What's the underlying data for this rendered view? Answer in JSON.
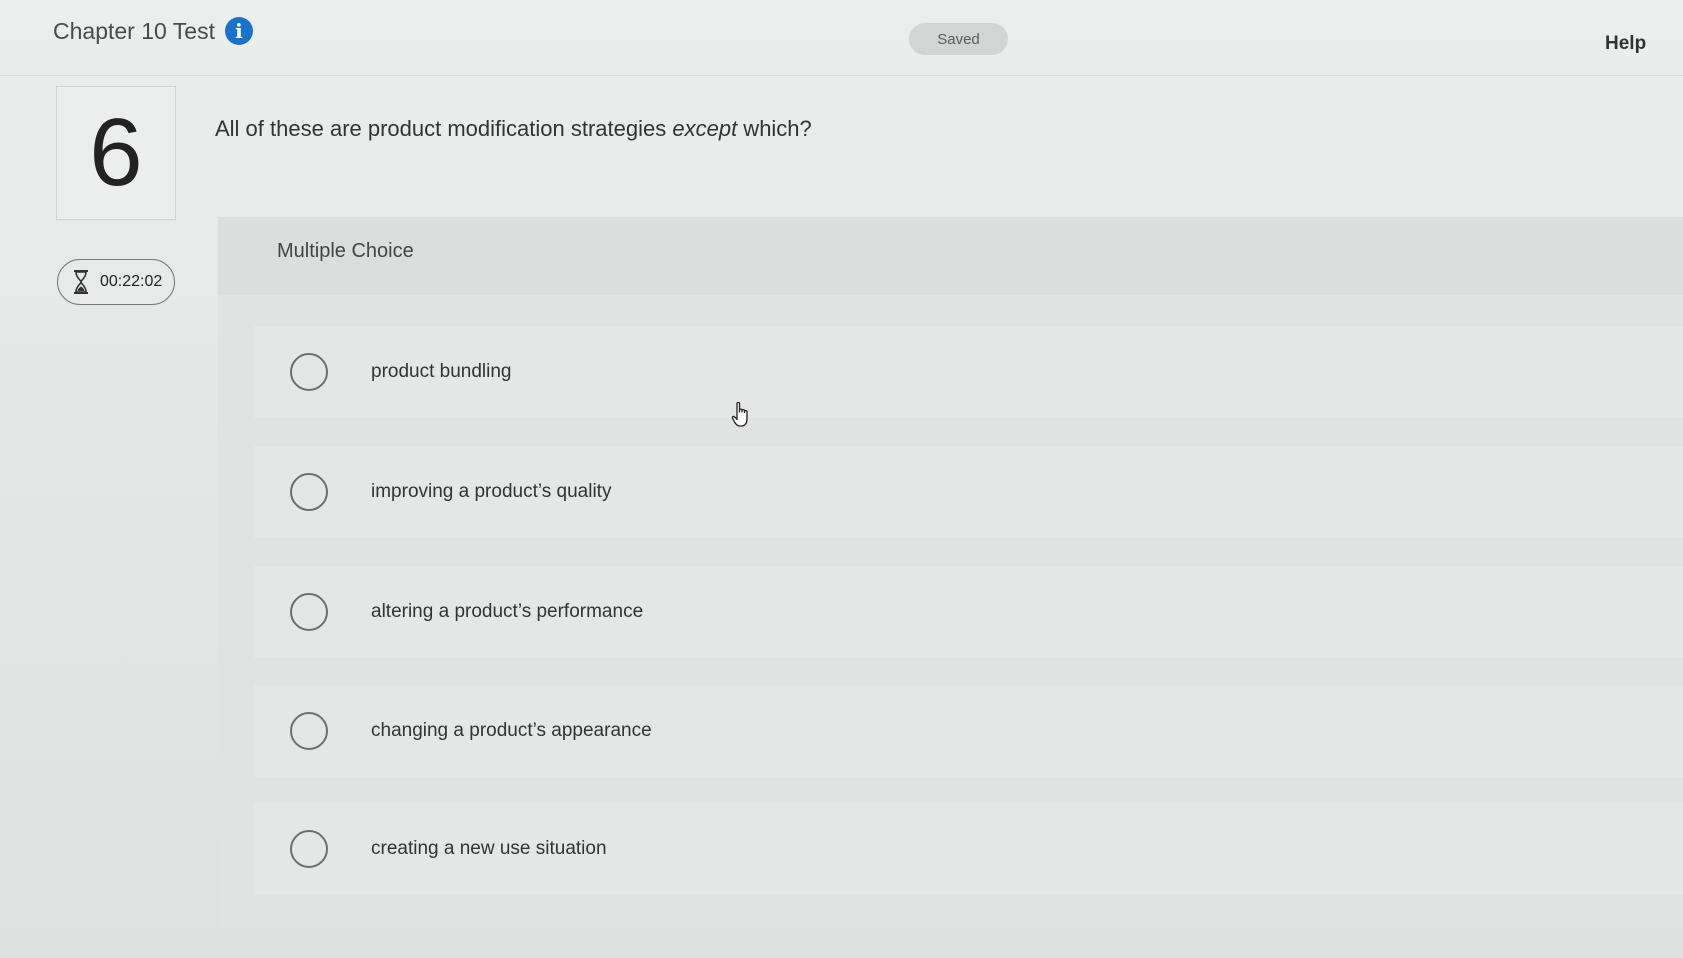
{
  "header": {
    "test_title": "Chapter 10 Test",
    "info_icon": "info-icon",
    "saved_label": "Saved",
    "help_label": "Help"
  },
  "question": {
    "number": "6",
    "text_before": "All of these are product modification strategies ",
    "text_emphasis": "except",
    "text_after": " which?"
  },
  "timer": {
    "icon": "hourglass-icon",
    "value": "00:22:02"
  },
  "multiple_choice": {
    "label": "Multiple Choice",
    "options": [
      {
        "label": "product bundling",
        "selected": false
      },
      {
        "label": "improving a product’s quality",
        "selected": false
      },
      {
        "label": "altering a product’s performance",
        "selected": false
      },
      {
        "label": "changing a product’s appearance",
        "selected": false
      },
      {
        "label": "creating a new use situation",
        "selected": false
      }
    ]
  },
  "colors": {
    "info_icon_bg": "#1a73c9",
    "background": "#e6e8e8"
  }
}
